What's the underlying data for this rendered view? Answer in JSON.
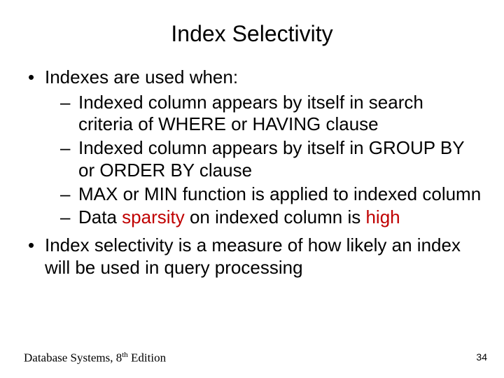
{
  "title": "Index Selectivity",
  "bullet1": {
    "lead": "Indexes are used when:"
  },
  "sub": {
    "a": "Indexed column appears by itself in search criteria of WHERE or HAVING clause",
    "b": "Indexed column appears by itself in GROUP BY or ORDER BY clause",
    "c": "MAX or MIN function is applied to indexed column",
    "d_pre": "Data ",
    "d_hl1": "sparsity",
    "d_mid": " on indexed column is ",
    "d_hl2": "high"
  },
  "bullet2": "Index selectivity is a measure of how likely an index will be used in query processing",
  "footer": {
    "book": "Database Systems, 8",
    "th": "th",
    "edition": " Edition",
    "page": "34"
  },
  "colors": {
    "highlight": "#c00000"
  }
}
